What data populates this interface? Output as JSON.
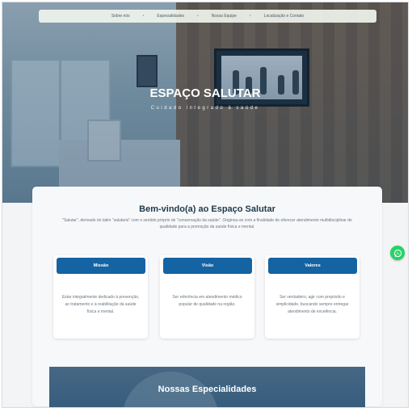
{
  "nav": {
    "items": [
      "Sobre nós",
      "Especialidades",
      "Nossa Equipe",
      "Localização e Contato"
    ]
  },
  "hero": {
    "title": "ESPAÇO SALUTAR",
    "subtitle": "Cuidado integrado à saúde"
  },
  "welcome": {
    "title": "Bem-vindo(a) ao Espaço Salutar",
    "intro": "\"Salutar\", derivado do latim \"salutaris\" com o sentido próprio de \"conservação da saúde\". Originou-se com a finalidade de oferecer atendimento multidisciplinar de qualidade para a promoção da saúde física e mental.",
    "columns": [
      {
        "label": "Missão",
        "text": "Estar integralmente dedicado à prevenção, ao tratamento e à reabilitação da saúde física e mental."
      },
      {
        "label": "Visão",
        "text": "Ser referência em atendimento médico popular de qualidade na região."
      },
      {
        "label": "Valores",
        "text": "Ser verdadeiro, agir com propósito e simplicidade, buscando sempre entregar atendimento de excelência."
      }
    ]
  },
  "specialties": {
    "title": "Nossas Especialidades"
  },
  "icons": {
    "whatsapp": "whatsapp-icon"
  },
  "colors": {
    "primary": "#1463a3",
    "heading": "#1b3a4b",
    "whatsapp": "#25d366"
  }
}
